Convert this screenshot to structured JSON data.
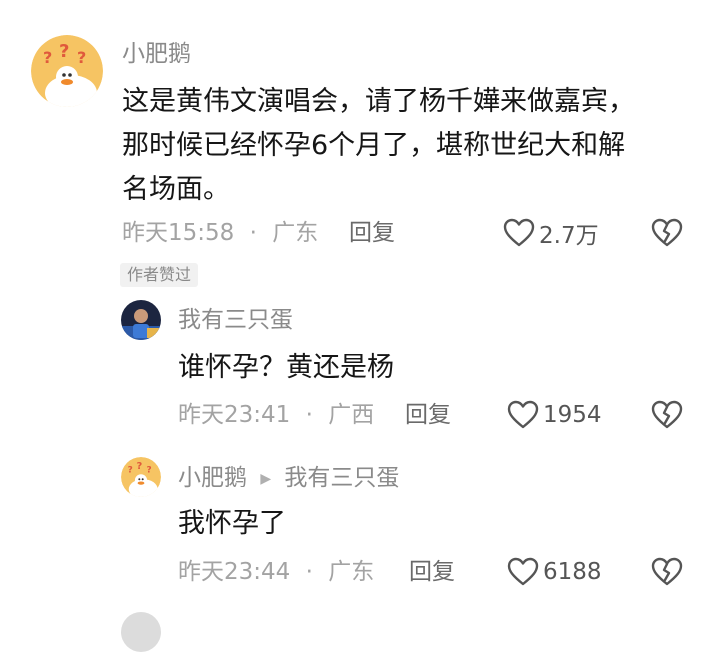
{
  "comment": {
    "author": "小肥鹅",
    "text_lines": [
      "这是黄伟文演唱会，请了杨千嬅来做嘉宾，",
      "那时候已经怀孕6个月了，堪称世纪大和解",
      "名场面。"
    ],
    "time": "昨天15:58",
    "location": "广东",
    "reply_label": "回复",
    "likes": "2.7万",
    "author_liked_tag": "作者赞过"
  },
  "replies": [
    {
      "author": "我有三只蛋",
      "text": "谁怀孕？黄还是杨",
      "time": "昨天23:41",
      "location": "广西",
      "reply_label": "回复",
      "likes": "1954"
    },
    {
      "author": "小肥鹅",
      "reply_to": "我有三只蛋",
      "text": "我怀孕了",
      "time": "昨天23:44",
      "location": "广东",
      "reply_label": "回复",
      "likes": "6188"
    }
  ],
  "meta_separator": "·",
  "icons": {
    "like": "heart-outline-icon",
    "dislike": "broken-heart-icon",
    "reply_arrow": "triangle-right-icon"
  },
  "colors": {
    "avatar_bg": "#f6c463",
    "goose": "#ffffff",
    "beak": "#f08a2c",
    "question_marks": "#e05a3c"
  }
}
